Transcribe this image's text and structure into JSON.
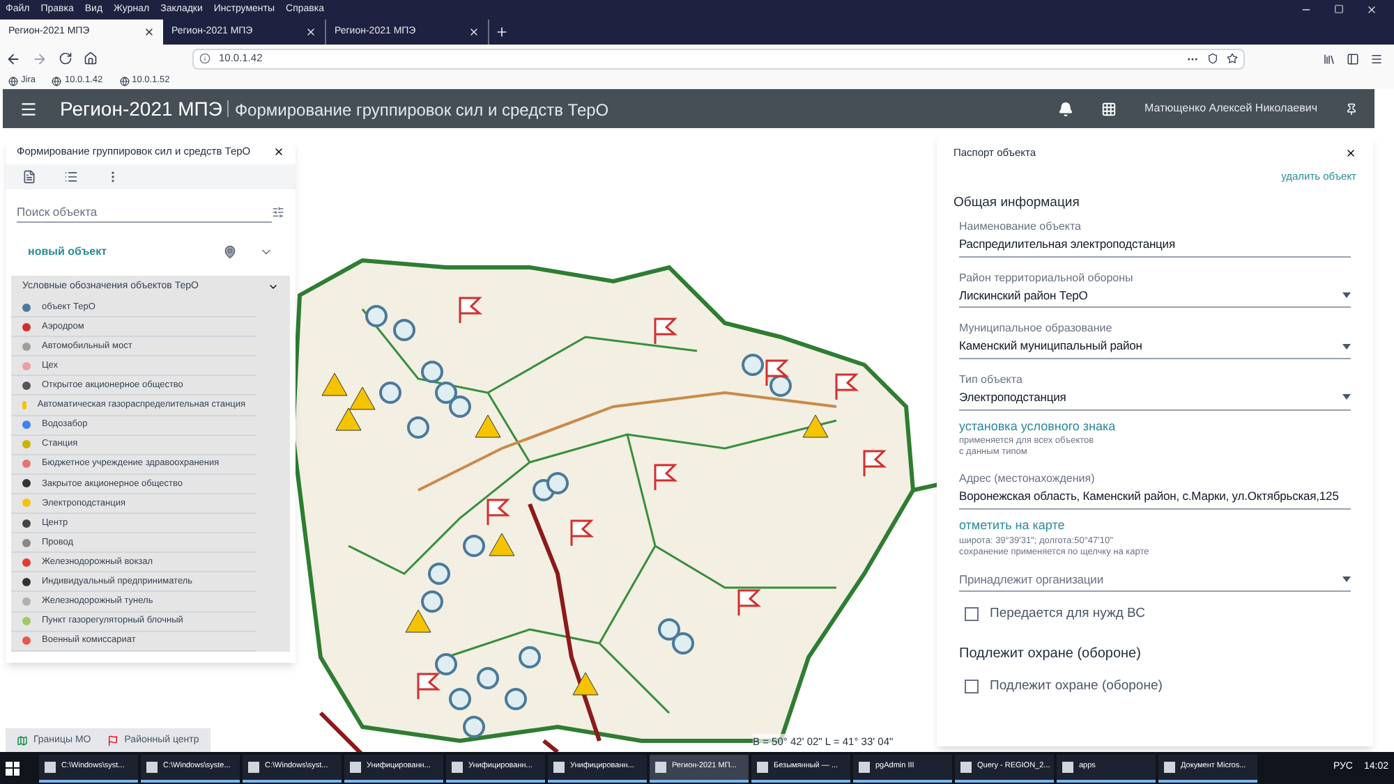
{
  "menu_bar": [
    "Файл",
    "Правка",
    "Вид",
    "Журнал",
    "Закладки",
    "Инструменты",
    "Справка"
  ],
  "browser_tabs": [
    {
      "label": "Регион-2021 МПЭ",
      "selected": true
    },
    {
      "label": "Регион-2021 МПЭ",
      "selected": false
    },
    {
      "label": "Регион-2021 МПЭ",
      "selected": false
    }
  ],
  "address": "10.0.1.42",
  "bookmarks": [
    "Jira",
    "10.0.1.42",
    "10.0.1.52"
  ],
  "app_header": {
    "title": "Регион-2021 МПЭ",
    "subtitle": "Формирование группировок сил и средств ТерО",
    "user": "Матющенко Алексей Николаевич"
  },
  "left_panel": {
    "title": "Формирование группировок сил и средств ТерО",
    "search_placeholder": "Поиск объекта",
    "new_object": "новый объект",
    "legend": {
      "title": "Условные обозначения объектов ТерО",
      "expanded": true,
      "items": [
        "объект ТерО",
        "Аэродром",
        "Автомобильный мост",
        "Цех",
        "Открытое акционерное общество",
        "Автоматическая газораспределительная станция",
        "Водозабор",
        "Станция",
        "Бюджетное учреждение здравоохранения",
        "Закрытое акционерное общество",
        "Электроподстанция",
        "Центр",
        "Провод",
        "Железнодорожный вокзал",
        "Индивидуальный предприниматель",
        "Железнодорожный тунель",
        "Пункт газорегуляторный блочный",
        "Военный комиссариат"
      ]
    }
  },
  "map_layers": [
    "Границы МО",
    "Районный центр"
  ],
  "coordinates": "B = 50° 42' 02\" L = 41° 33' 04\"",
  "right_panel": {
    "title": "Паспорт объекта",
    "delete_link": "удалить объект",
    "section": "Общая информация",
    "fields": [
      {
        "kind": "text",
        "label": "Наименование объекта",
        "value": "Распредилительная электроподстанция"
      },
      {
        "kind": "select",
        "label": "Район территориальной обороны",
        "value": "Лискинский район ТерО"
      },
      {
        "kind": "select",
        "label": "Муниципальное образование",
        "value": "Каменский муниципальный район"
      },
      {
        "kind": "select",
        "label": "Тип объекта",
        "value": "Электроподстанция"
      },
      {
        "kind": "link",
        "label": "установка условного знака",
        "note": "применяется для всех объектов\nс данным типом"
      },
      {
        "kind": "text",
        "label": "Адрес (местонахождения)",
        "value": "Воронежская область, Каменский район, с.Марки, ул.Октябрьская,125"
      },
      {
        "kind": "link",
        "label": "отметить на карте",
        "note": "широта: 39°39'31\"; долгота:50°47'10\"\nсохранение применяется по щелчку на карте"
      },
      {
        "kind": "select",
        "placeholder": "Принадлежит организации"
      },
      {
        "kind": "checkbox",
        "label": "Передается для нужд ВС",
        "checked": false
      },
      {
        "kind": "heading",
        "label": "Подлежит охране (обороне)"
      },
      {
        "kind": "checkbox",
        "label": "Подлежит охране (обороне)",
        "checked": false
      }
    ]
  },
  "taskbar": {
    "items": [
      {
        "label": "C:\\Windows\\syst...",
        "selected": false
      },
      {
        "label": "C:\\Windows\\syste...",
        "selected": false
      },
      {
        "label": "C:\\Windows\\syst...",
        "selected": false
      },
      {
        "label": "Унифицированн...",
        "selected": false
      },
      {
        "label": "Унифицированн...",
        "selected": false
      },
      {
        "label": "Унифицированн...",
        "selected": false
      },
      {
        "label": "Регион-2021 МП...",
        "selected": true
      },
      {
        "label": "Безымянный — ...",
        "selected": false
      },
      {
        "label": "pgAdmin III",
        "selected": false
      },
      {
        "label": "Query - REGION_2...",
        "selected": false
      },
      {
        "label": "apps",
        "selected": false
      },
      {
        "label": "Документ Micros...",
        "selected": false
      }
    ],
    "language": "РУС",
    "time": "14:02"
  }
}
